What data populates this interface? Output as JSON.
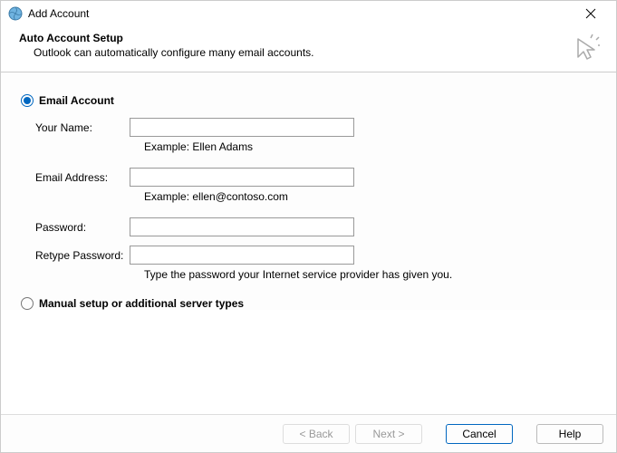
{
  "title": "Add Account",
  "header": {
    "title": "Auto Account Setup",
    "subtitle": "Outlook can automatically configure many email accounts."
  },
  "radio": {
    "email_account": "Email Account",
    "manual": "Manual setup or additional server types"
  },
  "form": {
    "name_label": "Your Name:",
    "name_value": "",
    "name_hint": "Example: Ellen Adams",
    "email_label": "Email Address:",
    "email_value": "",
    "email_hint": "Example: ellen@contoso.com",
    "password_label": "Password:",
    "password_value": "",
    "retype_label": "Retype Password:",
    "retype_value": "",
    "password_hint": "Type the password your Internet service provider has given you."
  },
  "buttons": {
    "back": "< Back",
    "next": "Next >",
    "cancel": "Cancel",
    "help": "Help"
  }
}
